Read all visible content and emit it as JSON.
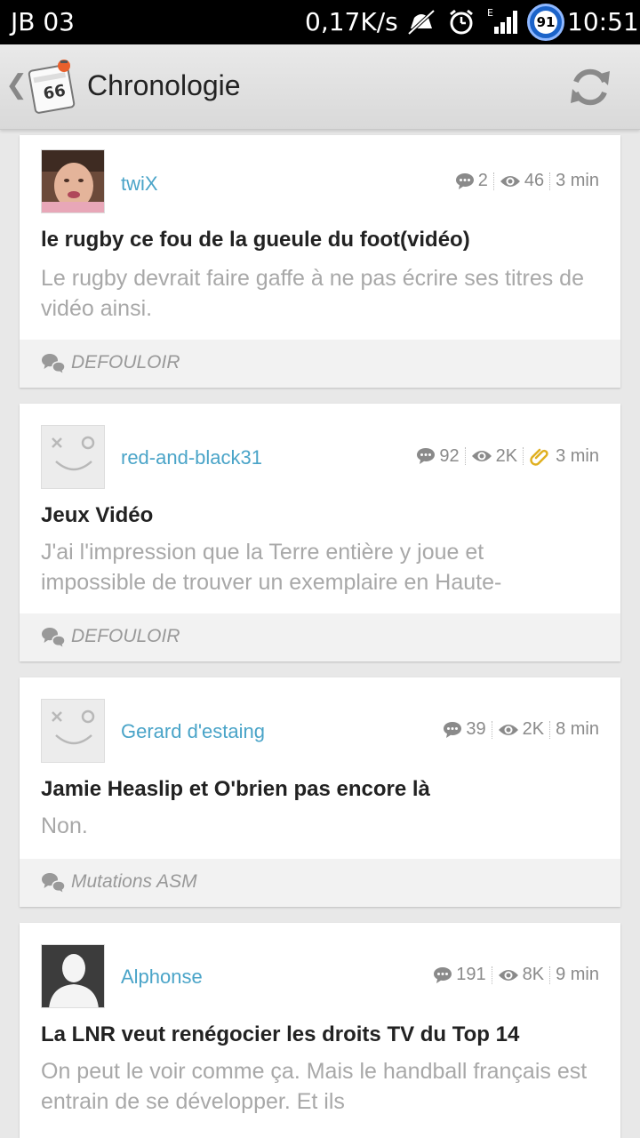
{
  "status_bar": {
    "carrier": "JB 03",
    "speed": "0,17K/s",
    "battery": "91",
    "time": "10:51"
  },
  "action_bar": {
    "title": "Chronologie",
    "back_icon": "chevron-left-icon",
    "refresh_icon": "refresh-icon"
  },
  "posts": [
    {
      "username": "twiX",
      "comments": "2",
      "views": "46",
      "time": "3 min",
      "title": "le rugby ce fou de la gueule du foot(vidéo)",
      "excerpt": "Le rugby devrait faire gaffe à ne pas écrire ses titres de vidéo ainsi.",
      "category": "DEFOULOIR"
    },
    {
      "username": "red-and-black31",
      "comments": "92",
      "views": "2K",
      "time": "3 min",
      "title": "Jeux Vidéo",
      "excerpt": "J'ai l'impression que la Terre entière y joue et impossible de trouver un exemplaire en Haute-",
      "category": "DEFOULOIR"
    },
    {
      "username": "Gerard d'estaing",
      "comments": "39",
      "views": "2K",
      "time": "8 min",
      "title": "Jamie Heaslip et O'brien pas encore là",
      "excerpt": "Non.",
      "category": "Mutations ASM"
    },
    {
      "username": "Alphonse",
      "comments": "191",
      "views": "8K",
      "time": "9 min",
      "title": "La LNR veut renégocier les droits TV du Top 14",
      "excerpt": "On peut le voir comme ça. Mais le handball français est entrain de se développer. Et ils",
      "category": ""
    }
  ]
}
